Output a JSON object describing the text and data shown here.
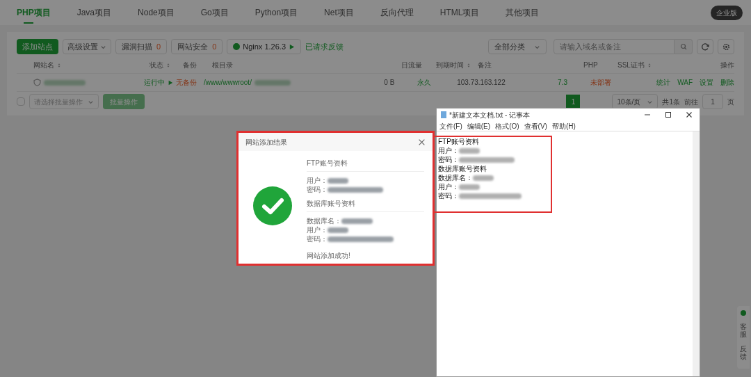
{
  "tabs": [
    {
      "label": "PHP项目",
      "selected": true
    },
    {
      "label": "Java项目",
      "selected": false
    },
    {
      "label": "Node项目",
      "selected": false
    },
    {
      "label": "Go项目",
      "selected": false
    },
    {
      "label": "Python项目",
      "selected": false
    },
    {
      "label": "Net项目",
      "selected": false
    },
    {
      "label": "反向代理",
      "selected": false
    },
    {
      "label": "HTML项目",
      "selected": false
    },
    {
      "label": "其他项目",
      "selected": false
    }
  ],
  "edition_badge": "企业版",
  "toolbar": {
    "add_button": "添加站点",
    "settings_select": "高级设置",
    "scan": {
      "label": "漏洞扫描",
      "count": "0"
    },
    "security": {
      "label": "网站安全",
      "count": "0"
    },
    "nginx": "Nginx 1.26.3",
    "feedback_link": "已请求反馈",
    "category_select": "全部分类",
    "search": {
      "placeholder": "请输入域名或备注"
    }
  },
  "table": {
    "columns": [
      {
        "label": "网站名",
        "sortable": true
      },
      {
        "label": "状态",
        "sortable": true
      },
      {
        "label": "备份",
        "sortable": false
      },
      {
        "label": "根目录",
        "sortable": false
      },
      {
        "label": "日流量",
        "sortable": false
      },
      {
        "label": "到期时间",
        "sortable": true
      },
      {
        "label": "备注",
        "sortable": false
      },
      {
        "label": "PHP",
        "sortable": false
      },
      {
        "label": "SSL证书",
        "sortable": true
      },
      {
        "label": "操作",
        "sortable": false
      }
    ],
    "rows": [
      {
        "status": "运行中",
        "backup": "无备份",
        "root": "/www/wwwroot/",
        "traffic": "0 B",
        "expiry": "永久",
        "note": "103.73.163.122",
        "php": "7.3",
        "ssl": "未部署",
        "actions": [
          "统计",
          "WAF",
          "设置",
          "删除"
        ]
      }
    ]
  },
  "footer": {
    "select_all_checked": false,
    "batch_placeholder": "请选择批量操作",
    "batch_button": "批量操作",
    "page": "1",
    "per_page": "10条/页",
    "total": "共1条",
    "goto": "前往",
    "goto_page": "1",
    "page_unit": "页"
  },
  "side_tabs": [
    "客服",
    "反馈"
  ],
  "dialog": {
    "title": "网站添加结果",
    "sections": [
      {
        "heading": "FTP账号资料",
        "lines": [
          "用户：",
          "密码："
        ]
      },
      {
        "heading": "数据库账号资料",
        "lines": [
          "数据库名：",
          "用户：",
          "密码："
        ]
      }
    ],
    "message": "网站添加成功!"
  },
  "notepad": {
    "title": "*新建文本文档.txt - 记事本",
    "menu": [
      "文件(F)",
      "编辑(E)",
      "格式(O)",
      "查看(V)",
      "帮助(H)"
    ],
    "lines": [
      {
        "text": "FTP账号资料",
        "redacted": false
      },
      {
        "text": "用户：",
        "redacted": true
      },
      {
        "text": "密码：",
        "redacted": true
      },
      {
        "text": "数据库账号资料",
        "redacted": false
      },
      {
        "text": "数据库名：",
        "redacted": true
      },
      {
        "text": "用户：",
        "redacted": true
      },
      {
        "text": "密码：",
        "redacted": true
      }
    ]
  }
}
